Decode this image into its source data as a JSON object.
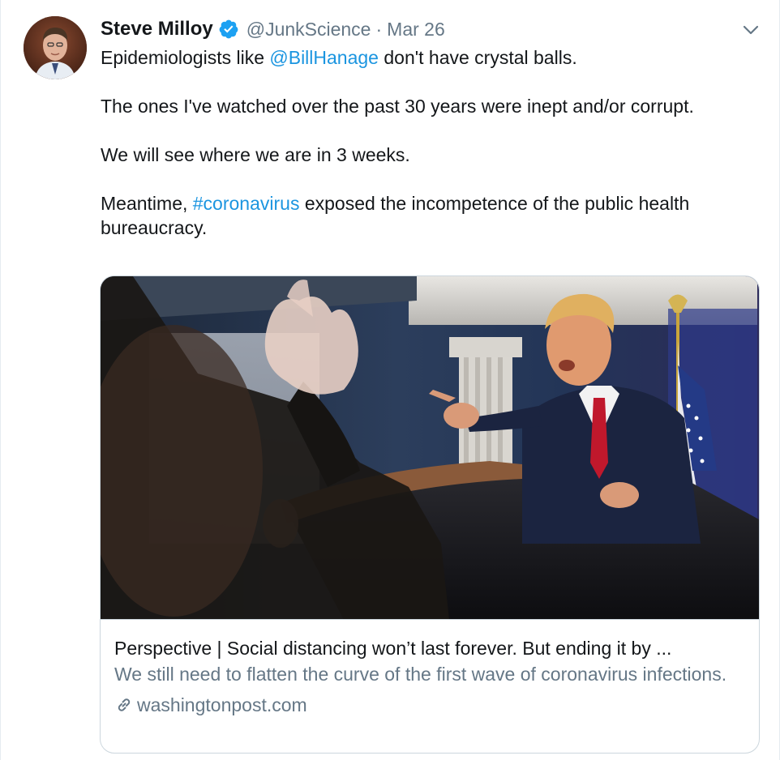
{
  "tweet": {
    "author": {
      "display_name": "Steve Milloy",
      "handle": "@JunkScience",
      "verified_icon": "verified-badge-icon"
    },
    "separator": "·",
    "date": "Mar 26",
    "menu_icon": "chevron-down-icon",
    "text": {
      "p1_pre": "Epidemiologists like ",
      "p1_mention": "@BillHanage",
      "p1_post": " don't have crystal balls.",
      "p2": "The ones I've watched over the past 30 years were inept and/or corrupt.",
      "p3": "We will see where we are in 3 weeks.",
      "p4_pre": "Meantime, ",
      "p4_hashtag": "#coronavirus",
      "p4_post": " exposed the incompetence of the public health bureaucracy."
    }
  },
  "card": {
    "title": "Perspective | Social distancing won’t last forever. But ending it by ...",
    "description": "We still need to flatten the curve of the first wave of coronavirus infections.",
    "domain": "washingtonpost.com",
    "domain_icon": "link-icon"
  },
  "colors": {
    "link": "#1b95e0",
    "secondary_text": "#657786",
    "border": "#ccd6dd"
  }
}
